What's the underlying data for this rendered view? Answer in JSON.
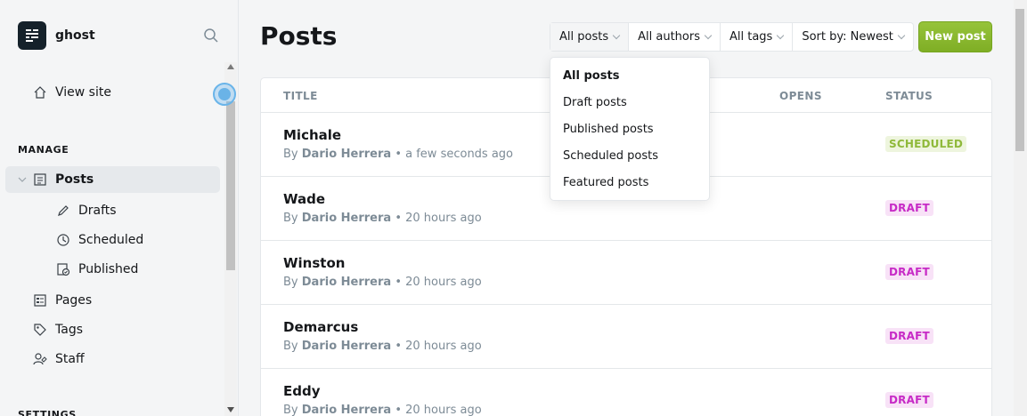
{
  "brand": {
    "name": "ghost"
  },
  "sidebar": {
    "view_site": "View site",
    "manage_label": "MANAGE",
    "settings_label": "SETTINGS",
    "items": [
      {
        "label": "Posts"
      },
      {
        "label": "Drafts"
      },
      {
        "label": "Scheduled"
      },
      {
        "label": "Published"
      },
      {
        "label": "Pages"
      },
      {
        "label": "Tags"
      },
      {
        "label": "Staff"
      }
    ]
  },
  "header": {
    "title": "Posts",
    "new_post": "New post",
    "filters": [
      {
        "label": "All posts"
      },
      {
        "label": "All authors"
      },
      {
        "label": "All tags"
      },
      {
        "label": "Sort by: Newest"
      }
    ]
  },
  "dropdown": {
    "options": [
      "All posts",
      "Draft posts",
      "Published posts",
      "Scheduled posts",
      "Featured posts"
    ],
    "selected": "All posts"
  },
  "table": {
    "columns": [
      "TITLE",
      "OPENS",
      "STATUS"
    ],
    "rows": [
      {
        "title": "Michale",
        "by": "By",
        "author": "Dario Herrera",
        "time": "• a few seconds ago",
        "status": "SCHEDULED"
      },
      {
        "title": "Wade",
        "by": "By",
        "author": "Dario Herrera",
        "time": "• 20 hours ago",
        "status": "DRAFT"
      },
      {
        "title": "Winston",
        "by": "By",
        "author": "Dario Herrera",
        "time": "• 20 hours ago",
        "status": "DRAFT"
      },
      {
        "title": "Demarcus",
        "by": "By",
        "author": "Dario Herrera",
        "time": "• 20 hours ago",
        "status": "DRAFT"
      },
      {
        "title": "Eddy",
        "by": "By",
        "author": "Dario Herrera",
        "time": "• 20 hours ago",
        "status": "DRAFT"
      }
    ]
  },
  "colors": {
    "accent_green": "#8ab72d",
    "scheduled_text": "#8fb93a",
    "draft_text": "#c72ac6"
  },
  "icons": [
    "ghost-logo-icon",
    "search-icon",
    "home-icon",
    "posts-icon",
    "pen-icon",
    "clock-icon",
    "published-icon",
    "pages-icon",
    "tag-icon",
    "staff-icon",
    "chevron-down-icon"
  ]
}
